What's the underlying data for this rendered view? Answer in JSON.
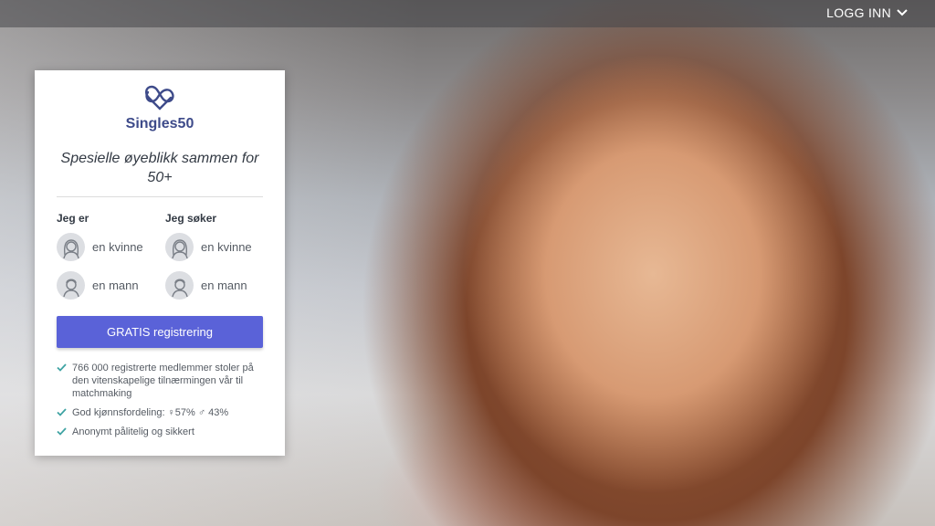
{
  "header": {
    "login_label": "LOGG INN",
    "login_icon": "chevron-down-icon"
  },
  "brand": {
    "name": "Singles50",
    "logo_icon": "heart-infinity-icon",
    "color": "#3e4b8a"
  },
  "card": {
    "tagline": "Spesielle øyeblikk sammen for 50+",
    "i_am_heading": "Jeg er",
    "seeking_heading": "Jeg søker",
    "i_am_options": [
      {
        "label": "en kvinne",
        "icon": "woman-avatar-icon"
      },
      {
        "label": "en mann",
        "icon": "man-avatar-icon"
      }
    ],
    "seeking_options": [
      {
        "label": "en kvinne",
        "icon": "woman-avatar-icon"
      },
      {
        "label": "en mann",
        "icon": "man-avatar-icon"
      }
    ],
    "cta_label": "GRATIS registrering",
    "cta_color": "#5a62d8",
    "features": [
      "766 000 registrerte medlemmer stoler på den vitenskapelige tilnærmingen vår til matchmaking",
      "God kjønnsfordeling: ♀57% ♂ 43%",
      "Anonymt pålitelig og sikkert"
    ],
    "check_color": "#3fa3a3"
  }
}
